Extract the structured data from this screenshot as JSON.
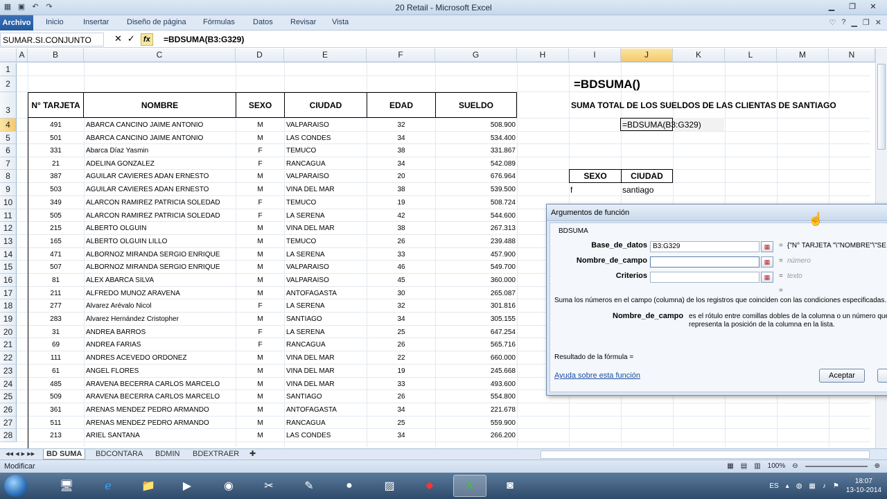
{
  "window": {
    "title": "20 Retail  -  Microsoft Excel"
  },
  "ribbon": {
    "tabs": [
      "Archivo",
      "Inicio",
      "Insertar",
      "Diseño de página",
      "Fórmulas",
      "Datos",
      "Revisar",
      "Vista"
    ]
  },
  "formula_bar": {
    "name_box": "SUMAR.SI.CONJUNTO",
    "formula": "=BDSUMA(B3:G329)"
  },
  "columns": [
    "A",
    "B",
    "C",
    "D",
    "E",
    "F",
    "G",
    "H",
    "I",
    "J",
    "K",
    "L",
    "M",
    "N"
  ],
  "rows": [
    "1",
    "2",
    "3",
    "4",
    "5",
    "6",
    "7",
    "8",
    "9",
    "10",
    "11",
    "12",
    "13",
    "14",
    "15",
    "16",
    "17",
    "18",
    "19",
    "20",
    "21",
    "22",
    "23",
    "24",
    "25",
    "26",
    "27",
    "28"
  ],
  "table": {
    "headers": [
      "N° TARJETA",
      "NOMBRE",
      "SEXO",
      "CIUDAD",
      "EDAD",
      "SUELDO"
    ],
    "rows": [
      [
        "491",
        "ABARCA CANCINO JAIME ANTONIO",
        "M",
        "VALPARAISO",
        "32",
        "508.900"
      ],
      [
        "501",
        "ABARCA CANCINO JAIME ANTONIO",
        "M",
        "LAS CONDES",
        "34",
        "534.400"
      ],
      [
        "331",
        "Abarca Díaz  Yasmin",
        "F",
        "TEMUCO",
        "38",
        "331.867"
      ],
      [
        "21",
        "ADELINA GONZALEZ",
        "F",
        "RANCAGUA",
        "34",
        "542.089"
      ],
      [
        "387",
        "AGUILAR CAVIERES ADAN ERNESTO",
        "M",
        "VALPARAISO",
        "20",
        "676.964"
      ],
      [
        "503",
        "AGUILAR CAVIERES ADAN ERNESTO",
        "M",
        "VIÑA DEL MAR",
        "38",
        "539.500"
      ],
      [
        "349",
        "ALARCON RAMIREZ PATRICIA SOLEDAD",
        "F",
        "TEMUCO",
        "19",
        "508.724"
      ],
      [
        "505",
        "ALARCON RAMIREZ PATRICIA SOLEDAD",
        "F",
        "LA SERENA",
        "42",
        "544.600"
      ],
      [
        "215",
        "ALBERTO OLGUIN",
        "M",
        "VIÑA DEL MAR",
        "38",
        "267.313"
      ],
      [
        "165",
        "ALBERTO OLGUIN LILLO",
        "M",
        "TEMUCO",
        "26",
        "239.488"
      ],
      [
        "471",
        "ALBORNOZ MIRANDA SERGIO  ENRIQUE",
        "M",
        "LA SERENA",
        "33",
        "457.900"
      ],
      [
        "507",
        "ALBORNOZ MIRANDA SERGIO  ENRIQUE",
        "M",
        "VALPARAISO",
        "46",
        "549.700"
      ],
      [
        "81",
        "ALEX ABARCA SILVA",
        "M",
        "VALPARAISO",
        "45",
        "360.000"
      ],
      [
        "211",
        "ALFREDO MUÑOZ ARAVENA",
        "M",
        "ANTOFAGASTA",
        "30",
        "265.087"
      ],
      [
        "277",
        "Álvarez Arévalo Nicol",
        "F",
        "LA SERENA",
        "32",
        "301.816"
      ],
      [
        "283",
        "Álvarez Hernández Cristopher",
        "M",
        "SANTIAGO",
        "34",
        "305.155"
      ],
      [
        "31",
        "ANDREA BARROS",
        "F",
        "LA SERENA",
        "25",
        "647.254"
      ],
      [
        "69",
        "ANDREA FARIAS",
        "F",
        "RANCAGUA",
        "26",
        "565.716"
      ],
      [
        "111",
        "ANDRES ACEVEDO ORDOÑEZ",
        "M",
        "VIÑA DEL MAR",
        "22",
        "660.000"
      ],
      [
        "61",
        "ANGEL FLORES",
        "M",
        "VIÑA DEL MAR",
        "19",
        "245.668"
      ],
      [
        "485",
        "ARAVENA BECERRA CARLOS MARCELO",
        "M",
        "VIÑA DEL MAR",
        "33",
        "493.600"
      ],
      [
        "509",
        "ARAVENA BECERRA CARLOS MARCELO",
        "M",
        "SANTIAGO",
        "26",
        "554.800"
      ],
      [
        "361",
        "ARENAS MENDEZ PEDRO ARMANDO",
        "M",
        "ANTOFAGASTA",
        "34",
        "221.678"
      ],
      [
        "511",
        "ARENAS MENDEZ PEDRO ARMANDO",
        "M",
        "RANCAGUA",
        "25",
        "559.900"
      ],
      [
        "213",
        "ARIEL SANTANA",
        "M",
        "LAS CONDES",
        "34",
        "266.200"
      ]
    ]
  },
  "side": {
    "func_title": "=BDSUMA()",
    "description": "SUMA TOTAL DE LOS SUELDOS DE LAS CLIENTAS DE SANTIAGO",
    "edit_cell": "=BDSUMA(B3:G329)",
    "criteria_headers": [
      "SEXO",
      "CIUDAD"
    ],
    "criteria_values": [
      "f",
      "santiago"
    ]
  },
  "dialog": {
    "title": "Argumentos de función",
    "func_name": "BDSUMA",
    "args": [
      {
        "label": "Base_de_datos",
        "value": "B3:G329",
        "result": "{\"N° TARJETA \"\\\"NOMBRE\"\\\"SE"
      },
      {
        "label": "Nombre_de_campo",
        "value": "",
        "result": "número"
      },
      {
        "label": "Criterios",
        "value": "",
        "result": "texto"
      }
    ],
    "eq": "=",
    "summary": "Suma los números en el campo (columna) de los registros que coinciden con las condiciones especificadas.",
    "arg_help_name": "Nombre_de_campo",
    "arg_help_line1": "es el rótulo entre comillas dobles de la columna o un número que",
    "arg_help_line2": "representa la posición de la columna en la lista.",
    "result_label": "Resultado de la fórmula =",
    "help_link": "Ayuda sobre esta función",
    "ok": "Aceptar",
    "cancel": "C"
  },
  "sheets": [
    "BD SUMA",
    "BDCONTARA",
    "BDMIN",
    "BDEXTRAER"
  ],
  "status": {
    "mode": "Modificar",
    "zoom": "100%"
  },
  "taskbar": {
    "lang": "ES",
    "time": "18:07",
    "date": "13-10-2014"
  }
}
